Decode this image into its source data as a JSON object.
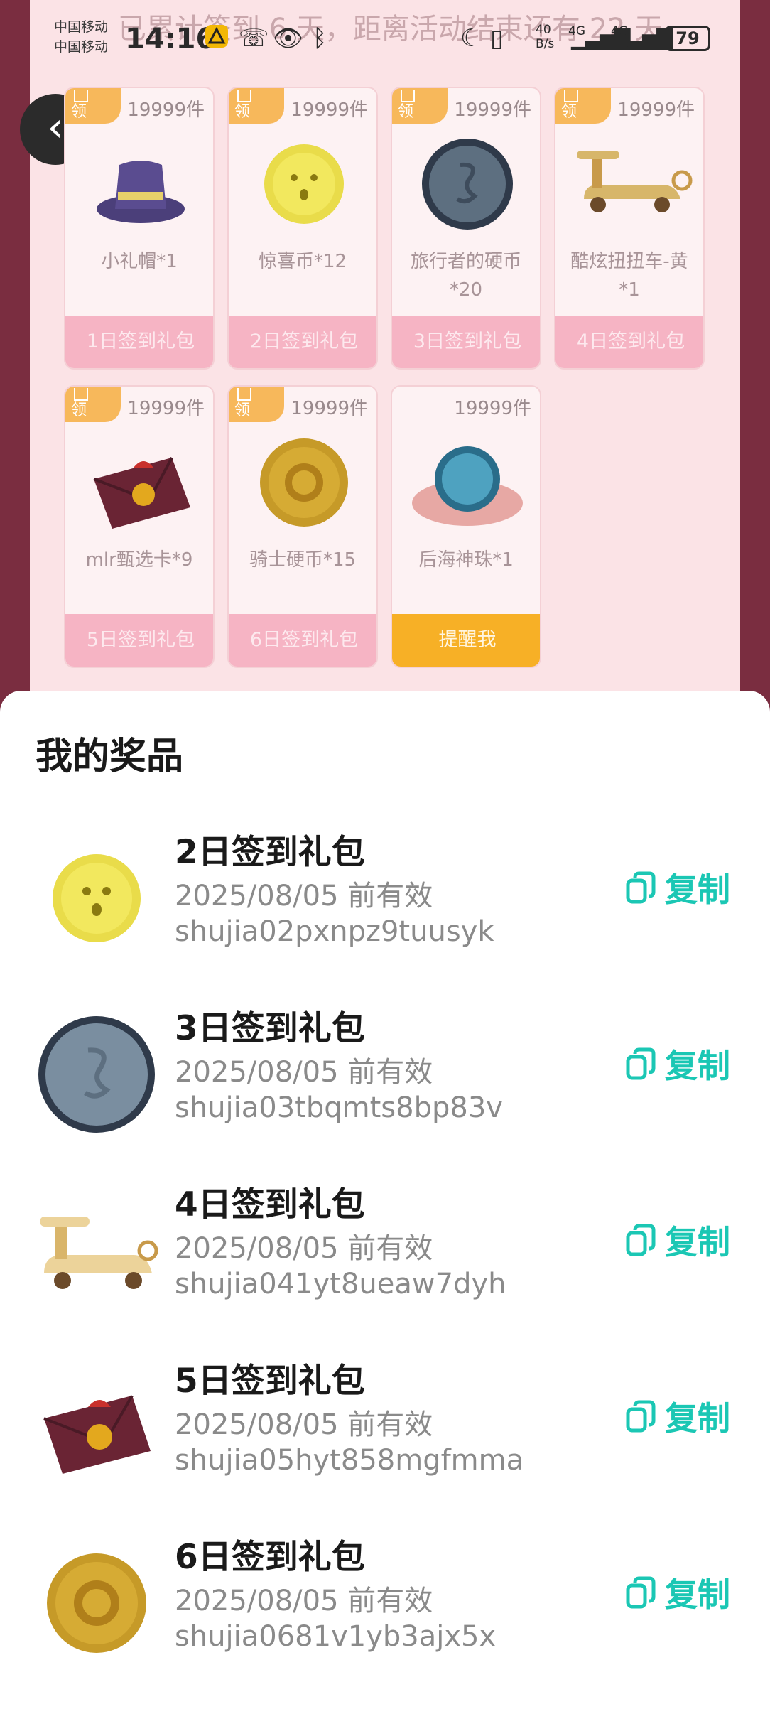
{
  "headline": "已累计签到 6 天，距离活动结束还有 22 天",
  "status_bar": {
    "carrier_1": "中国移动",
    "carrier_2": "中国移动",
    "time": "14:16",
    "net_speed_value": "40",
    "net_speed_unit": "B/s",
    "sim1_type": "4G",
    "sim2_type": "4G",
    "battery": "79"
  },
  "cards": [
    {
      "tag": "领",
      "count": "19999件",
      "name": "小礼帽*1",
      "footer": "1日签到礼包",
      "icon": "top-hat-icon"
    },
    {
      "tag": "领",
      "count": "19999件",
      "name": "惊喜币*12",
      "footer": "2日签到礼包",
      "icon": "surprise-coin-icon"
    },
    {
      "tag": "领",
      "count": "19999件",
      "name": "旅行者的硬币*20",
      "footer": "3日签到礼包",
      "icon": "traveler-coin-icon"
    },
    {
      "tag": "领",
      "count": "19999件",
      "name": "酷炫扭扭车-黄*1",
      "footer": "4日签到礼包",
      "icon": "scooter-icon"
    },
    {
      "tag": "领",
      "count": "19999件",
      "name": "mlr甄选卡*9",
      "footer": "5日签到礼包",
      "icon": "envelope-card-icon"
    },
    {
      "tag": "领",
      "count": "19999件",
      "name": "骑士硬币*15",
      "footer": "6日签到礼包",
      "icon": "knight-coin-icon"
    },
    {
      "tag": "",
      "count": "19999件",
      "name": "后海神珠*1",
      "footer": "提醒我",
      "icon": "pearl-shell-icon"
    }
  ],
  "sheet": {
    "title": "我的奖品",
    "copy_label": "复制",
    "prizes": [
      {
        "name": "2日签到礼包",
        "expiry": "2025/08/05 前有效",
        "code": "shujia02pxnpz9tuusyk",
        "icon": "surprise-coin-icon"
      },
      {
        "name": "3日签到礼包",
        "expiry": "2025/08/05 前有效",
        "code": "shujia03tbqmts8bp83v",
        "icon": "traveler-coin-icon"
      },
      {
        "name": "4日签到礼包",
        "expiry": "2025/08/05 前有效",
        "code": "shujia041yt8ueaw7dyh",
        "icon": "scooter-icon"
      },
      {
        "name": "5日签到礼包",
        "expiry": "2025/08/05 前有效",
        "code": "shujia05hyt858mgfmma",
        "icon": "envelope-card-icon"
      },
      {
        "name": "6日签到礼包",
        "expiry": "2025/08/05 前有效",
        "code": "shujia0681v1yb3ajx5x",
        "icon": "knight-coin-icon"
      }
    ]
  },
  "colors": {
    "accent": "#1bc7b4",
    "card_footer": "#f6b4c4",
    "remind": "#f7b026"
  }
}
